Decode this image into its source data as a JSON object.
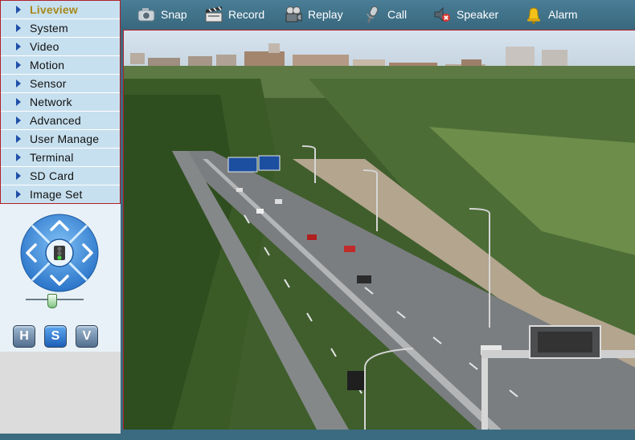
{
  "sidebar": {
    "items": [
      {
        "label": "Liveview"
      },
      {
        "label": "System"
      },
      {
        "label": "Video"
      },
      {
        "label": "Motion"
      },
      {
        "label": "Sensor"
      },
      {
        "label": "Network"
      },
      {
        "label": "Advanced"
      },
      {
        "label": "User Manage"
      },
      {
        "label": "Terminal"
      },
      {
        "label": "SD Card"
      },
      {
        "label": "Image Set"
      }
    ],
    "active": "Liveview"
  },
  "ptz": {
    "buttons": {
      "h": "H",
      "s": "S",
      "v": "V"
    },
    "slider_level": 0.45
  },
  "toolbar": {
    "snap": "Snap",
    "record": "Record",
    "replay": "Replay",
    "call": "Call",
    "speaker": "Speaker",
    "alarm": "Alarm"
  },
  "video": {
    "sign_text": ""
  },
  "colors": {
    "menu_bg": "#c7e0ef",
    "active_text": "#a7891a",
    "toolbar_bg": "#3f7088",
    "border_red": "#b0202a",
    "ptz_blue": "#2f7fd4"
  }
}
